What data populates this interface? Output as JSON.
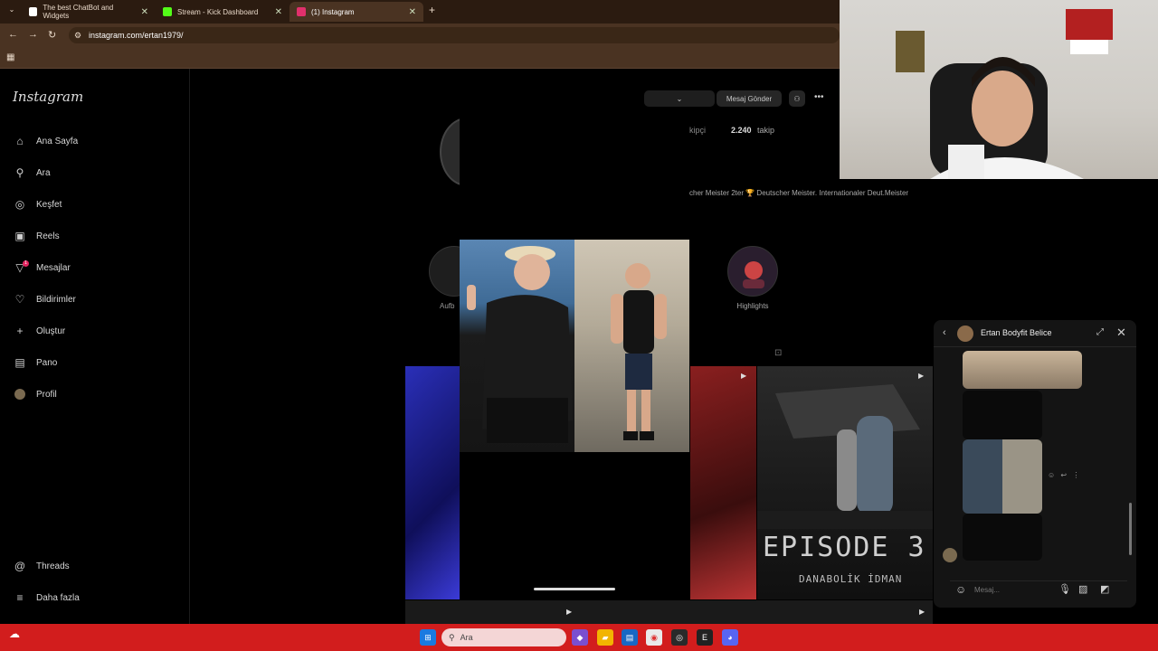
{
  "browser": {
    "tabs": [
      {
        "label": "The best ChatBot and Widgets",
        "active": false,
        "color": "#ffffff"
      },
      {
        "label": "Stream - Kick Dashboard",
        "active": false,
        "color": "#53fc18"
      },
      {
        "label": "(1) Instagram",
        "active": true,
        "color": "#e1306c"
      }
    ],
    "url": "instagram.com/ertan1979/"
  },
  "sidebar": {
    "logo": "Instagram",
    "items": [
      {
        "label": "Ana Sayfa",
        "icon": "home-icon"
      },
      {
        "label": "Ara",
        "icon": "search-icon"
      },
      {
        "label": "Keşfet",
        "icon": "compass-icon"
      },
      {
        "label": "Reels",
        "icon": "reels-icon"
      },
      {
        "label": "Mesajlar",
        "icon": "messenger-icon",
        "badge": "1"
      },
      {
        "label": "Bildirimler",
        "icon": "heart-icon"
      },
      {
        "label": "Oluştur",
        "icon": "plus-icon"
      },
      {
        "label": "Pano",
        "icon": "dashboard-icon"
      },
      {
        "label": "Profil",
        "icon": "profile-avatar-icon"
      }
    ],
    "bottom_items": [
      {
        "label": "Threads",
        "icon": "threads-icon"
      },
      {
        "label": "Daha fazla",
        "icon": "menu-icon"
      }
    ]
  },
  "profile": {
    "message_button": "Mesaj Gönder",
    "followers_fragment": "kipçi",
    "following_count": "2.240",
    "following_label": "takip",
    "bio": "cher Meister 2ter 🏆 Deutscher Meister. Internationaler Deut.Meister",
    "highlight_label": "Highlights",
    "highlight_left_fragment": "Aufb",
    "post_title": "EPISODE 3",
    "post_subtitle": "DANABOLİK İDMAN"
  },
  "chat": {
    "name": "Ertan Bodyfit Belice",
    "placeholder": "Mesaj..."
  },
  "taskbar": {
    "search_placeholder": "Ara"
  },
  "colors": {
    "taskbar": "#d21d1d",
    "browser_chrome": "#4a3322",
    "ig_background": "#000000"
  }
}
